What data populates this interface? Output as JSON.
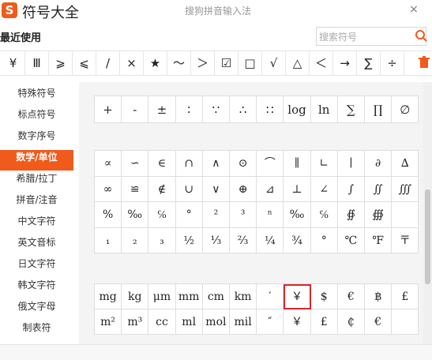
{
  "app": {
    "logo": "S",
    "title": "符号大全",
    "subtitle": "搜狗拼音输入法",
    "close": "×"
  },
  "recent": {
    "label": "最近使用",
    "symbols": [
      "¥",
      "Ⅲ",
      "⩾",
      "⩽",
      "/",
      "×",
      "★",
      "～",
      "＞",
      "☑",
      "□",
      "√",
      "△",
      "＜",
      "→",
      "∑",
      "÷"
    ]
  },
  "search": {
    "placeholder": "搜索符号"
  },
  "sidebar": {
    "items": [
      {
        "label": "特殊符号",
        "active": false
      },
      {
        "label": "标点符号",
        "active": false
      },
      {
        "label": "数字序号",
        "active": false
      },
      {
        "label": "数学/单位",
        "active": true
      },
      {
        "label": "希腊/拉丁",
        "active": false
      },
      {
        "label": "拼音/注音",
        "active": false
      },
      {
        "label": "中文字符",
        "active": false
      },
      {
        "label": "英文音标",
        "active": false
      },
      {
        "label": "日文字符",
        "active": false
      },
      {
        "label": "韩文字符",
        "active": false
      },
      {
        "label": "俄文字母",
        "active": false
      },
      {
        "label": "制表符",
        "active": false
      }
    ]
  },
  "math_grid_top": {
    "cells": [
      "+",
      "-",
      "±",
      "∶",
      "∵",
      "∴",
      "∷",
      "log",
      "ln",
      "∑",
      "∏",
      "∅"
    ]
  },
  "math_grid_main": {
    "rows": [
      [
        "∝",
        "∽",
        "∈",
        "∩",
        "∧",
        "⊙",
        "⌒",
        "∥",
        "∟",
        "∣",
        "∂",
        "∆"
      ],
      [
        "∞",
        "≌",
        "∉",
        "∪",
        "∨",
        "⊕",
        "⊿",
        "⊥",
        "∠",
        "∫",
        "∬",
        "∭"
      ],
      [
        "%",
        "‰",
        "℅",
        "°",
        "²",
        "³",
        "ⁿ",
        "‰",
        "℅",
        "∯",
        "∰",
        ""
      ],
      [
        "₁",
        "₂",
        "₃",
        "½",
        "⅓",
        "⅔",
        "¼",
        "¾",
        "°",
        "℃",
        "℉",
        "〒"
      ]
    ]
  },
  "unit_grid": {
    "rows": [
      [
        "mg",
        "kg",
        "μm",
        "mm",
        "cm",
        "km",
        "′",
        "￥",
        "$",
        "€",
        "฿",
        "£"
      ],
      [
        "m²",
        "m³",
        "cc",
        "ml",
        "mol",
        "mil",
        "″",
        "￥",
        "£",
        "₵",
        "€",
        ""
      ]
    ],
    "highlighted": "￥"
  },
  "colors": {
    "accent": "#f05a1a",
    "highlight": "#d9262b"
  }
}
